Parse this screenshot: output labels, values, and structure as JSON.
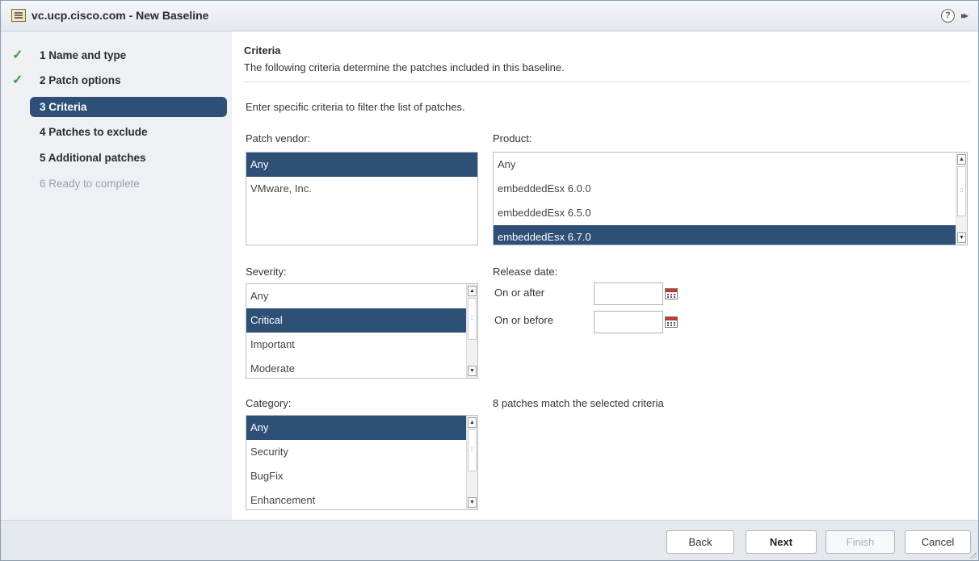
{
  "window": {
    "title": "vc.ucp.cisco.com - New Baseline",
    "help_glyph": "?",
    "expand_glyph": "▸▸"
  },
  "steps": [
    {
      "label": "1  Name and type",
      "state": "done"
    },
    {
      "label": "2  Patch options",
      "state": "done"
    },
    {
      "label": "3  Criteria",
      "state": "active"
    },
    {
      "label": "4  Patches to exclude",
      "state": "pending"
    },
    {
      "label": "5  Additional patches",
      "state": "pending"
    },
    {
      "label": "6  Ready to complete",
      "state": "disabled"
    }
  ],
  "main": {
    "title": "Criteria",
    "description": "The following criteria determine the patches included in this baseline.",
    "intro": "Enter specific criteria to filter the list of patches.",
    "vendor": {
      "label": "Patch vendor:",
      "options": [
        "Any",
        "VMware, Inc."
      ],
      "selected": "Any"
    },
    "product": {
      "label": "Product:",
      "options": [
        "Any",
        "embeddedEsx 6.0.0",
        "embeddedEsx 6.5.0",
        "embeddedEsx 6.7.0"
      ],
      "selected": "embeddedEsx 6.7.0"
    },
    "severity": {
      "label": "Severity:",
      "options": [
        "Any",
        "Critical",
        "Important",
        "Moderate"
      ],
      "selected": "Critical"
    },
    "release_date": {
      "label": "Release date:",
      "on_or_after": "On or after",
      "on_or_before": "On or before",
      "after_value": "",
      "before_value": ""
    },
    "category": {
      "label": "Category:",
      "options": [
        "Any",
        "Security",
        "BugFix",
        "Enhancement"
      ],
      "selected": "Any"
    },
    "match_text": "8 patches match the selected criteria"
  },
  "footer": {
    "back": "Back",
    "next": "Next",
    "finish": "Finish",
    "cancel": "Cancel"
  },
  "colors": {
    "selection": "#2e5077",
    "check": "#3c9a3c",
    "sidebar_bg": "#eef0f4",
    "footer_bg": "#e5e8ed"
  }
}
